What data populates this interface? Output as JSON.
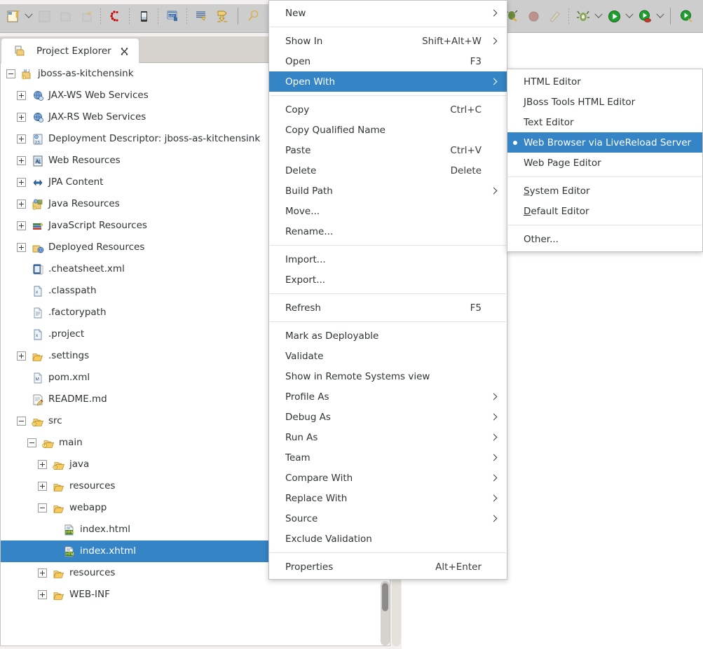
{
  "toolbar": {
    "left_buttons": [
      {
        "name": "new-wizard-icon",
        "label": "New"
      },
      {
        "name": "new-dropdown-arrow",
        "label": "New menu"
      },
      {
        "name": "save-icon",
        "label": "Save"
      },
      {
        "name": "save-all-icon",
        "label": "Save All"
      },
      {
        "name": "print-icon",
        "label": "Print"
      },
      {
        "name": "jboss-central-icon",
        "label": "JBoss Central"
      },
      {
        "name": "mobile-browser-icon",
        "label": "Mobile Web Browser"
      },
      {
        "name": "project-icon",
        "label": "Open Project"
      },
      {
        "name": "marker-icon",
        "label": "Markers"
      },
      {
        "name": "deploy-icon",
        "label": "Deploy"
      },
      {
        "name": "search-icon",
        "label": "Search"
      }
    ],
    "right_buttons": [
      {
        "name": "external-tools-icon",
        "label": "External Tools"
      },
      {
        "name": "coverage-icon",
        "label": "Coverage"
      },
      {
        "name": "profile-icon",
        "label": "Profile"
      },
      {
        "name": "debug-icon",
        "label": "Debug"
      },
      {
        "name": "debug-dropdown-arrow",
        "label": "Debug History"
      },
      {
        "name": "run-icon",
        "label": "Run"
      },
      {
        "name": "run-dropdown-arrow",
        "label": "Run History"
      },
      {
        "name": "run-server-icon",
        "label": "Run on Server"
      },
      {
        "name": "run-server-dropdown-arrow",
        "label": "Run on Server History"
      },
      {
        "name": "profile-run-icon",
        "label": "Profile As"
      }
    ]
  },
  "view": {
    "tab_title": "Project Explorer"
  },
  "tree": {
    "items": [
      {
        "label": "jboss-as-kitchensink",
        "indent": 0,
        "twisty": "minus",
        "icon": "maven-project-icon",
        "selected": false
      },
      {
        "label": "JAX-WS Web Services",
        "indent": 1,
        "twisty": "plus",
        "icon": "web-service-icon",
        "selected": false
      },
      {
        "label": "JAX-RS Web Services",
        "indent": 1,
        "twisty": "plus",
        "icon": "web-service-icon",
        "selected": false
      },
      {
        "label": "Deployment Descriptor: jboss-as-kitchensink",
        "indent": 1,
        "twisty": "plus",
        "icon": "deployment-descriptor-icon",
        "selected": false
      },
      {
        "label": "Web Resources",
        "indent": 1,
        "twisty": "plus",
        "icon": "web-resources-icon",
        "selected": false
      },
      {
        "label": "JPA Content",
        "indent": 1,
        "twisty": "plus",
        "icon": "jpa-content-icon",
        "selected": false
      },
      {
        "label": "Java Resources",
        "indent": 1,
        "twisty": "plus",
        "icon": "java-resources-icon",
        "selected": false
      },
      {
        "label": "JavaScript Resources",
        "indent": 1,
        "twisty": "plus",
        "icon": "javascript-resources-icon",
        "selected": false
      },
      {
        "label": "Deployed Resources",
        "indent": 1,
        "twisty": "plus",
        "icon": "deployed-resources-icon",
        "selected": false
      },
      {
        "label": ".cheatsheet.xml",
        "indent": 1,
        "twisty": "none",
        "icon": "cheatsheet-icon",
        "selected": false
      },
      {
        "label": ".classpath",
        "indent": 1,
        "twisty": "none",
        "icon": "xml-file-icon",
        "selected": false
      },
      {
        "label": ".factorypath",
        "indent": 1,
        "twisty": "none",
        "icon": "text-file-icon",
        "selected": false
      },
      {
        "label": ".project",
        "indent": 1,
        "twisty": "none",
        "icon": "xml-file-icon",
        "selected": false
      },
      {
        "label": ".settings",
        "indent": 1,
        "twisty": "plus",
        "icon": "folder-icon",
        "selected": false
      },
      {
        "label": "pom.xml",
        "indent": 1,
        "twisty": "none",
        "icon": "maven-pom-icon",
        "selected": false
      },
      {
        "label": "README.md",
        "indent": 1,
        "twisty": "none",
        "icon": "markdown-file-icon",
        "selected": false
      },
      {
        "label": "src",
        "indent": 1,
        "twisty": "minus",
        "icon": "source-folder-icon",
        "selected": false
      },
      {
        "label": "main",
        "indent": 2,
        "twisty": "minus",
        "icon": "source-folder-icon",
        "selected": false
      },
      {
        "label": "java",
        "indent": 3,
        "twisty": "plus",
        "icon": "source-folder-icon",
        "selected": false
      },
      {
        "label": "resources",
        "indent": 3,
        "twisty": "plus",
        "icon": "folder-icon",
        "selected": false
      },
      {
        "label": "webapp",
        "indent": 3,
        "twisty": "minus",
        "icon": "folder-icon",
        "selected": false
      },
      {
        "label": "index.html",
        "indent": 4,
        "twisty": "none",
        "icon": "html-file-icon",
        "selected": false
      },
      {
        "label": "index.xhtml",
        "indent": 4,
        "twisty": "none",
        "icon": "html-file-icon",
        "selected": true
      },
      {
        "label": "resources",
        "indent": 3,
        "twisty": "plus",
        "icon": "folder-icon",
        "selected": false
      },
      {
        "label": "WEB-INF",
        "indent": 3,
        "twisty": "plus",
        "icon": "folder-icon",
        "selected": false
      }
    ]
  },
  "context_menu": {
    "items": [
      {
        "type": "item",
        "label": "New",
        "accel": "",
        "arrow": true,
        "highlight": false
      },
      {
        "type": "sep"
      },
      {
        "type": "item",
        "label": "Show In",
        "accel": "Shift+Alt+W",
        "arrow": true,
        "highlight": false
      },
      {
        "type": "item",
        "label": "Open",
        "accel": "F3",
        "arrow": false,
        "highlight": false
      },
      {
        "type": "item",
        "label": "Open With",
        "accel": "",
        "arrow": true,
        "highlight": true
      },
      {
        "type": "sep"
      },
      {
        "type": "item",
        "label": "Copy",
        "accel": "Ctrl+C",
        "arrow": false,
        "highlight": false
      },
      {
        "type": "item",
        "label": "Copy Qualified Name",
        "accel": "",
        "arrow": false,
        "highlight": false
      },
      {
        "type": "item",
        "label": "Paste",
        "accel": "Ctrl+V",
        "arrow": false,
        "highlight": false
      },
      {
        "type": "item",
        "label": "Delete",
        "accel": "Delete",
        "arrow": false,
        "highlight": false
      },
      {
        "type": "item",
        "label": "Build Path",
        "accel": "",
        "arrow": true,
        "highlight": false
      },
      {
        "type": "item",
        "label": "Move...",
        "accel": "",
        "arrow": false,
        "highlight": false
      },
      {
        "type": "item",
        "label": "Rename...",
        "accel": "",
        "arrow": false,
        "highlight": false
      },
      {
        "type": "sep"
      },
      {
        "type": "item",
        "label": "Import...",
        "accel": "",
        "arrow": false,
        "highlight": false
      },
      {
        "type": "item",
        "label": "Export...",
        "accel": "",
        "arrow": false,
        "highlight": false
      },
      {
        "type": "sep"
      },
      {
        "type": "item",
        "label": "Refresh",
        "accel": "F5",
        "arrow": false,
        "highlight": false
      },
      {
        "type": "sep"
      },
      {
        "type": "item",
        "label": "Mark as Deployable",
        "accel": "",
        "arrow": false,
        "highlight": false
      },
      {
        "type": "item",
        "label": "Validate",
        "accel": "",
        "arrow": false,
        "highlight": false
      },
      {
        "type": "item",
        "label": "Show in Remote Systems view",
        "accel": "",
        "arrow": false,
        "highlight": false
      },
      {
        "type": "item",
        "label": "Profile As",
        "accel": "",
        "arrow": true,
        "highlight": false
      },
      {
        "type": "item",
        "label": "Debug As",
        "accel": "",
        "arrow": true,
        "highlight": false
      },
      {
        "type": "item",
        "label": "Run As",
        "accel": "",
        "arrow": true,
        "highlight": false
      },
      {
        "type": "item",
        "label": "Team",
        "accel": "",
        "arrow": true,
        "highlight": false
      },
      {
        "type": "item",
        "label": "Compare With",
        "accel": "",
        "arrow": true,
        "highlight": false
      },
      {
        "type": "item",
        "label": "Replace With",
        "accel": "",
        "arrow": true,
        "highlight": false
      },
      {
        "type": "item",
        "label": "Source",
        "accel": "",
        "arrow": true,
        "highlight": false
      },
      {
        "type": "item",
        "label": "Exclude Validation",
        "accel": "",
        "arrow": false,
        "highlight": false
      },
      {
        "type": "sep"
      },
      {
        "type": "item",
        "label": "Properties",
        "accel": "Alt+Enter",
        "arrow": false,
        "highlight": false
      }
    ]
  },
  "submenu": {
    "title": "Open With",
    "items": [
      {
        "type": "item",
        "label": "HTML Editor",
        "bullet": false,
        "highlight": false,
        "mnemonic": ""
      },
      {
        "type": "item",
        "label": "JBoss Tools HTML Editor",
        "bullet": false,
        "highlight": false,
        "mnemonic": ""
      },
      {
        "type": "item",
        "label": "Text Editor",
        "bullet": false,
        "highlight": false,
        "mnemonic": ""
      },
      {
        "type": "item",
        "label": "Web Browser via LiveReload Server",
        "bullet": true,
        "highlight": true,
        "mnemonic": ""
      },
      {
        "type": "item",
        "label": "Web Page Editor",
        "bullet": false,
        "highlight": false,
        "mnemonic": ""
      },
      {
        "type": "sep"
      },
      {
        "type": "item",
        "label": "System Editor",
        "bullet": false,
        "highlight": false,
        "mnemonic": "S"
      },
      {
        "type": "item",
        "label": "Default Editor",
        "bullet": false,
        "highlight": false,
        "mnemonic": "D"
      },
      {
        "type": "sep"
      },
      {
        "type": "item",
        "label": "Other...",
        "bullet": false,
        "highlight": false,
        "mnemonic": ""
      }
    ]
  },
  "colors": {
    "selection_blue": "#3584c6",
    "toolbar_gray": "#cdcdcd",
    "tabrow_gray": "#d6d2cd",
    "menu_bg": "#ffffff",
    "text": "#2e3436"
  }
}
